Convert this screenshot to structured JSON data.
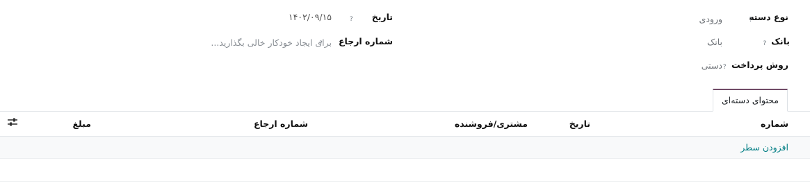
{
  "form": {
    "batch_type": {
      "label": "نوع دسته",
      "help": "?",
      "value": "ورودی"
    },
    "bank": {
      "label": "بانک",
      "help": "?",
      "value": "بانک"
    },
    "payment_method": {
      "label": "روش پرداخت",
      "help": "?",
      "value": "دستی"
    },
    "date": {
      "label": "تاریخ",
      "help": "?",
      "value": "۱۴۰۲/۰۹/۱۵"
    },
    "reference": {
      "label": "شماره ارجاع",
      "help": "?",
      "placeholder": "برای ایجاد خودکار خالی بگذارید..."
    }
  },
  "tabs": [
    {
      "label": "محتوای دسته‌ای",
      "active": true
    }
  ],
  "table": {
    "columns": [
      "شماره",
      "تاریخ",
      "مشتری/فروشنده",
      "شماره ارجاع",
      "مبلغ"
    ],
    "add_line": "افزودن سطر",
    "settings_icon": "sliders-icon"
  }
}
